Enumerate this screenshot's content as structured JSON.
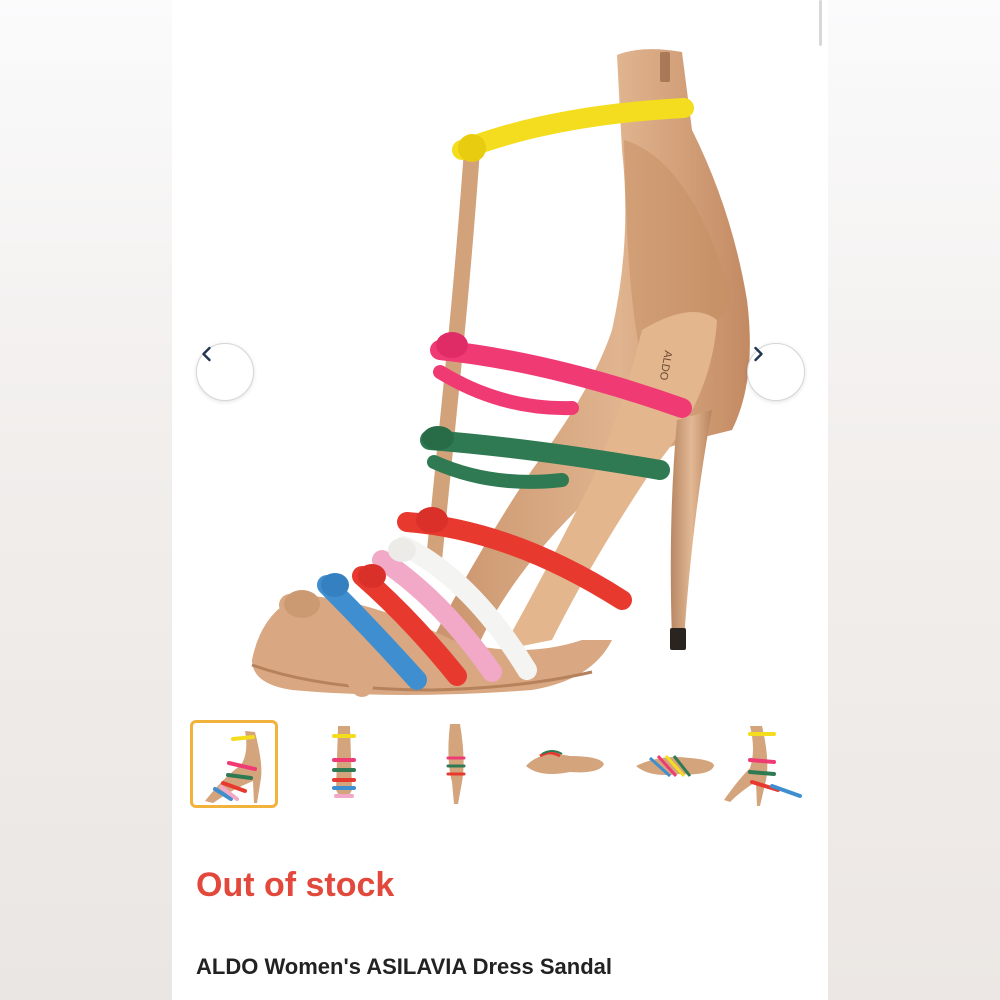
{
  "product": {
    "stock_status": "Out of stock",
    "title": "ALDO Women's ASILAVIA Dress Sandal"
  },
  "image": {
    "brand_marking": "ALDO"
  },
  "carousel": {
    "prev_icon": "chevron-left-icon",
    "next_icon": "chevron-right-icon",
    "thumbnail_count": 6,
    "selected_index": 0
  },
  "colors": {
    "stock_status": "#e2483b",
    "selected_thumbnail_border": "#f2b33d",
    "strap_yellow": "#f4dc1e",
    "strap_pink": "#f03a74",
    "strap_green": "#2f7a52",
    "strap_red": "#e8392f",
    "strap_blue": "#3f8fd0",
    "strap_light_pink": "#f2a9c7",
    "strap_white": "#f4f4f2",
    "leather_nude": "#d8a982"
  }
}
